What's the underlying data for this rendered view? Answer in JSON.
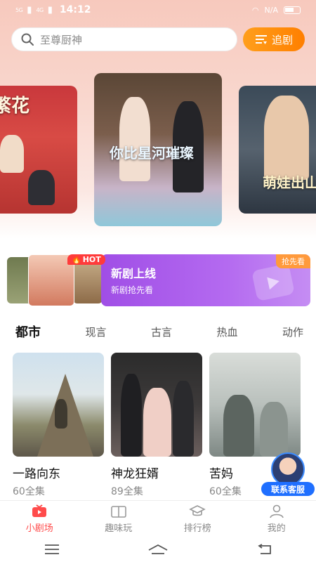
{
  "status": {
    "left": "5G",
    "left2": "4G",
    "time": "14:12",
    "right": "N/A"
  },
  "search": {
    "placeholder": "至尊厨神"
  },
  "header": {
    "follow_label": "追剧"
  },
  "carousel": {
    "left_title": "繁花",
    "center_title": "你比星河璀璨",
    "right_title": "萌娃出山"
  },
  "banner": {
    "hot_label": "HOT",
    "title": "新剧上线",
    "subtitle": "新剧抢先看",
    "badge": "抢先看"
  },
  "categories": [
    "都市",
    "现言",
    "古言",
    "热血",
    "动作"
  ],
  "dramas": [
    {
      "title": "一路向东",
      "episodes": "60全集"
    },
    {
      "title": "神龙狂婿",
      "episodes": "89全集"
    },
    {
      "title": "苦妈",
      "episodes": "60全集"
    }
  ],
  "customer_service": {
    "label": "联系客服"
  },
  "nav": [
    {
      "label": "小剧场",
      "icon": "tv-icon"
    },
    {
      "label": "趣味玩",
      "icon": "book-icon"
    },
    {
      "label": "排行榜",
      "icon": "trophy-icon"
    },
    {
      "label": "我的",
      "icon": "user-icon"
    }
  ],
  "colors": {
    "accent": "#ff8a00",
    "active_nav": "#ff4b4b",
    "banner_purple": "#a04ee6"
  }
}
